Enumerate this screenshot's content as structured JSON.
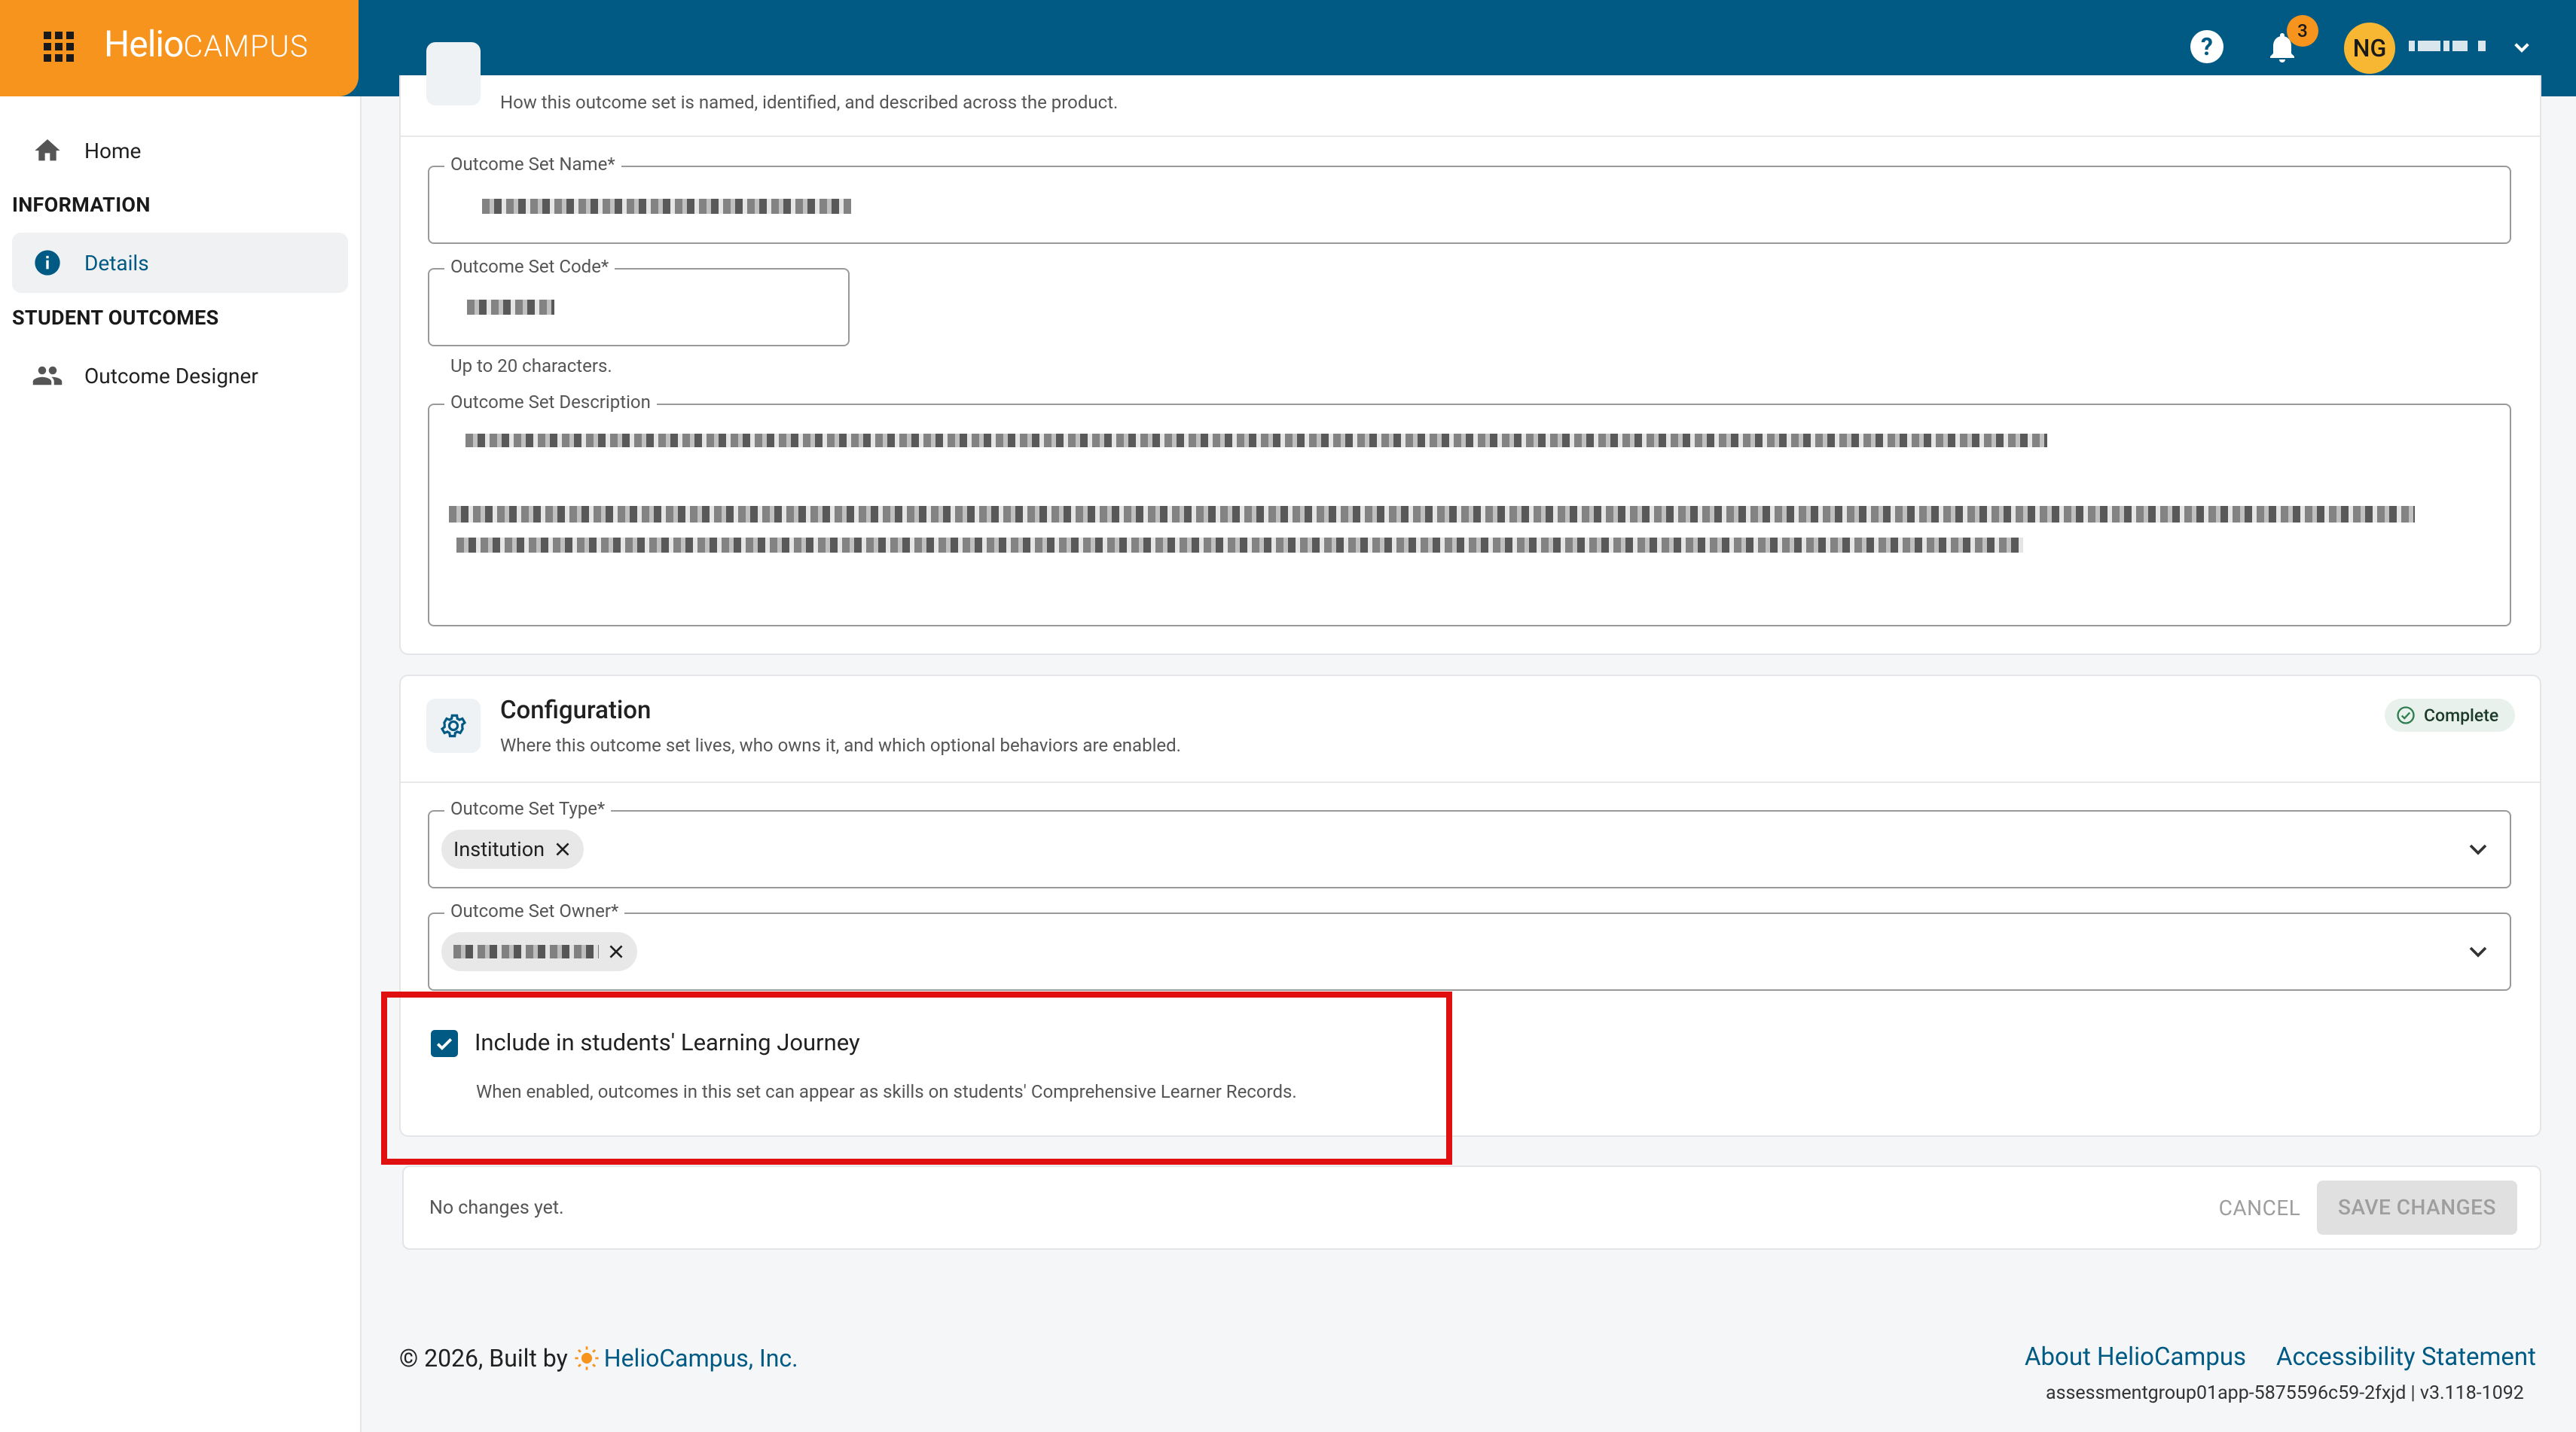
{
  "header": {
    "logo_bold": "Helio",
    "logo_caps": "CAMPUS",
    "notification_count": "3",
    "avatar_initials": "NG",
    "colors": {
      "topbar": "#005a84",
      "brand": "#f7941d"
    }
  },
  "sidebar": {
    "home_label": "Home",
    "section_information": "INFORMATION",
    "details_label": "Details",
    "section_student_outcomes": "STUDENT OUTCOMES",
    "outcome_designer_label": "Outcome Designer"
  },
  "identity": {
    "subtitle": "How this outcome set is named, identified, and described across the product.",
    "name_label": "Outcome Set Name",
    "code_label": "Outcome Set Code",
    "code_helper": "Up to 20 characters.",
    "description_label": "Outcome Set Description",
    "required_mark": "*"
  },
  "configuration": {
    "title": "Configuration",
    "subtitle": "Where this outcome set lives, who owns it, and which optional behaviors are enabled.",
    "status": "Complete",
    "type_label": "Outcome Set Type",
    "type_chip": "Institution",
    "owner_label": "Outcome Set Owner",
    "learning_journey_label": "Include in students' Learning Journey",
    "learning_journey_help": "When enabled, outcomes in this set can appear as skills on students' Comprehensive Learner Records.",
    "learning_journey_checked": true
  },
  "actions": {
    "status_text": "No changes yet.",
    "cancel_label": "CANCEL",
    "save_label": "SAVE CHANGES"
  },
  "footer": {
    "copyright_prefix": "© 2026, Built by",
    "company_link": "HelioCampus, Inc.",
    "about_link": "About HelioCampus",
    "accessibility_link": "Accessibility Statement",
    "version": "assessmentgroup01app-5875596c59-2fxjd | v3.118-1092"
  }
}
